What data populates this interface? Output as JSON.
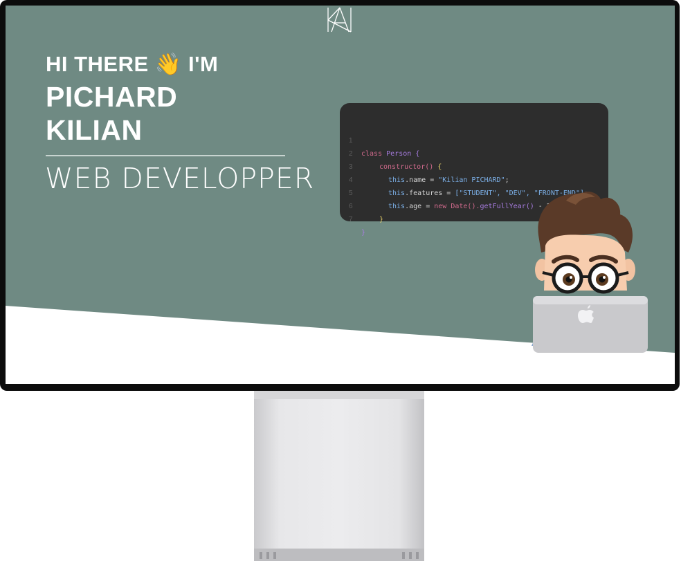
{
  "hero": {
    "greeting": "HI THERE 👋 I'M",
    "first_name": "PICHARD",
    "last_name": "KILIAN",
    "role": "WEB DEVELOPPER"
  },
  "code": {
    "line_numbers": [
      "1",
      "2",
      "3",
      "4",
      "5",
      "6",
      "7"
    ],
    "l1_kw": "class",
    "l1_cls": "Person",
    "l1_brace": "{",
    "l2_fn": "constructor()",
    "l2_brace": "{",
    "l3_this": "this",
    "l3_prop": ".name = ",
    "l3_str": "\"Kilian PICHARD\"",
    "l3_end": ";",
    "l4_this": "this",
    "l4_prop": ".features = ",
    "l4_str": "[\"STUDENT\", \"DEV\", \"FRONT-END\"]",
    "l4_end": ";",
    "l5_this": "this",
    "l5_prop": ".age = ",
    "l5_kw": "new",
    "l5_fn": "Date().",
    "l5_fn2": "getFullYear()",
    "l5_rest": " - 2001;",
    "l6_brace": "}",
    "l7_brace": "}"
  },
  "icons": {
    "logo": "ka-monogram-logo",
    "avatar": "memoji-avatar-with-laptop",
    "laptop_logo": "apple-icon"
  },
  "colors": {
    "hero_bg": "#6f8a83",
    "code_bg": "#2d2d2d",
    "bezel": "#0c0c0c"
  }
}
